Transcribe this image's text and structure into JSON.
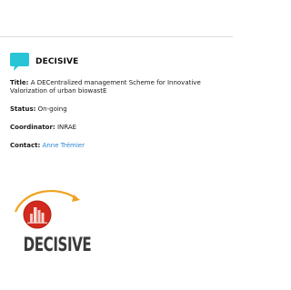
{
  "project": {
    "name": "DECISIVE",
    "icon": "speech-bubble-icon",
    "accent_color": "#29c4d6",
    "fields": {
      "title_label": "Title:",
      "title_value": "A DECentralized management Scheme for Innovative Valorization of urban biowastE",
      "status_label": "Status:",
      "status_value": "On-going",
      "coordinator_label": "Coordinator:",
      "coordinator_value": "INRAE",
      "contact_label": "Contact:",
      "contact_value": "Anne Trémier"
    },
    "link_color": "#2a83d6",
    "logo": {
      "wordmark": "DECISIVE",
      "circle_color": "#d22a1e",
      "arc_color": "#f0a21f"
    }
  }
}
